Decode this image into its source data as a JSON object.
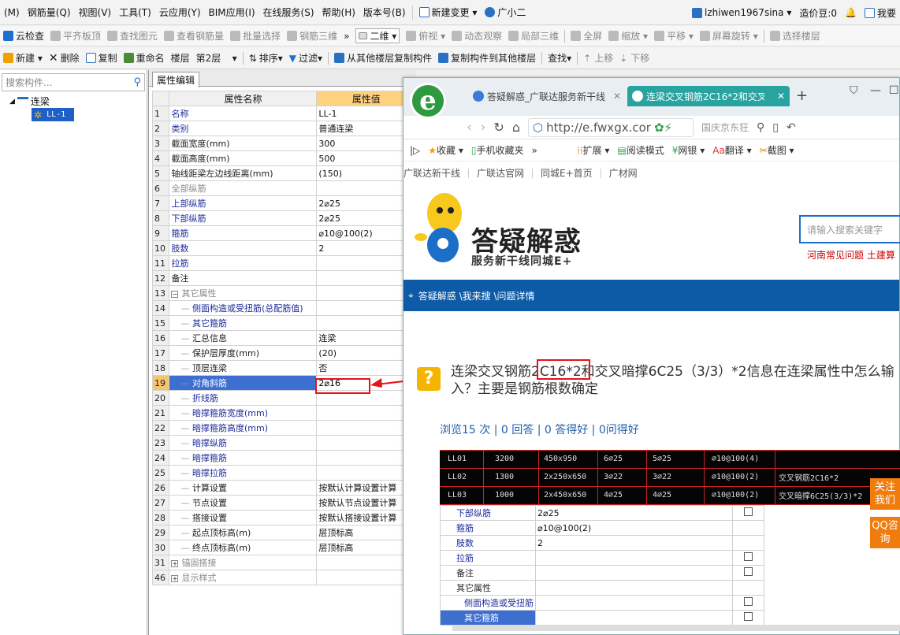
{
  "menubar": {
    "items": [
      "(M)",
      "钢筋量(Q)",
      "视图(V)",
      "工具(T)",
      "云应用(Y)",
      "BIM应用(I)",
      "在线服务(S)",
      "帮助(H)",
      "版本号(B)"
    ],
    "new_change": "新建变更",
    "assistant": "广小二",
    "user": "lzhiwen1967sina",
    "coins": "造价豆:0",
    "ask": "我要"
  },
  "toolbar1": {
    "cloud_check": "云检查",
    "flush_slab": "平齐板顶",
    "find_element": "查找图元",
    "view_rebar": "查看钢筋量",
    "batch_select": "批量选择",
    "rebar_3d": "钢筋三维",
    "view_mode": "二维",
    "top_view": "俯视",
    "dynamic_view": "动态观察",
    "local_3d": "局部三维",
    "full_screen": "全屏",
    "zoom": "缩放",
    "pan": "平移",
    "rotate": "屏幕旋转",
    "select_floor": "选择楼层"
  },
  "toolbar2": {
    "new": "新建",
    "delete": "删除",
    "copy": "复制",
    "rename": "重命名",
    "floor_label": "楼层",
    "floor_value": "第2层",
    "sort": "排序",
    "filter": "过滤",
    "copy_from": "从其他楼层复制构件",
    "copy_to": "复制构件到其他楼层",
    "find": "查找",
    "move_up": "上移",
    "move_down": "下移"
  },
  "left_panel": {
    "search_placeholder": "搜索构件...",
    "tree_root": "连梁",
    "tree_child": "LL-1"
  },
  "grid": {
    "tab": "属性编辑",
    "col_name": "属性名称",
    "col_value": "属性值",
    "rows": [
      {
        "num": "1",
        "name": "名称",
        "value": "LL-1",
        "style": "n"
      },
      {
        "num": "2",
        "name": "类别",
        "value": "普通连梁",
        "style": "n"
      },
      {
        "num": "3",
        "name": "截面宽度(mm)",
        "value": "300",
        "style": "k"
      },
      {
        "num": "4",
        "name": "截面高度(mm)",
        "value": "500",
        "style": "k"
      },
      {
        "num": "5",
        "name": "轴线距梁左边线距离(mm)",
        "value": "(150)",
        "style": "k"
      },
      {
        "num": "6",
        "name": "全部纵筋",
        "value": "",
        "style": "g"
      },
      {
        "num": "7",
        "name": "上部纵筋",
        "value": "2⌀25",
        "style": "n"
      },
      {
        "num": "8",
        "name": "下部纵筋",
        "value": "2⌀25",
        "style": "n"
      },
      {
        "num": "9",
        "name": "箍筋",
        "value": "⌀10@100(2)",
        "style": "n"
      },
      {
        "num": "10",
        "name": "肢数",
        "value": "2",
        "style": "n"
      },
      {
        "num": "11",
        "name": "拉筋",
        "value": "",
        "style": "n"
      },
      {
        "num": "12",
        "name": "备注",
        "value": "",
        "style": "k"
      },
      {
        "num": "13",
        "name": "其它属性",
        "value": "",
        "style": "g",
        "group": true
      },
      {
        "num": "14",
        "name": "侧面构造或受扭筋(总配筋值)",
        "value": "",
        "style": "n",
        "child": true
      },
      {
        "num": "15",
        "name": "其它箍筋",
        "value": "",
        "style": "n",
        "child": true
      },
      {
        "num": "16",
        "name": "汇总信息",
        "value": "连梁",
        "style": "k",
        "child": true
      },
      {
        "num": "17",
        "name": "保护层厚度(mm)",
        "value": "(20)",
        "style": "k",
        "child": true
      },
      {
        "num": "18",
        "name": "顶层连梁",
        "value": "否",
        "style": "k",
        "child": true
      },
      {
        "num": "19",
        "name": "对角斜筋",
        "value": "2⌀16",
        "style": "n",
        "child": true,
        "selected": true
      },
      {
        "num": "20",
        "name": "折线筋",
        "value": "",
        "style": "n",
        "child": true
      },
      {
        "num": "21",
        "name": "暗撑箍筋宽度(mm)",
        "value": "",
        "style": "n",
        "child": true
      },
      {
        "num": "22",
        "name": "暗撑箍筋高度(mm)",
        "value": "",
        "style": "n",
        "child": true
      },
      {
        "num": "23",
        "name": "暗撑纵筋",
        "value": "",
        "style": "n",
        "child": true
      },
      {
        "num": "24",
        "name": "暗撑箍筋",
        "value": "",
        "style": "n",
        "child": true
      },
      {
        "num": "25",
        "name": "暗撑拉筋",
        "value": "",
        "style": "n",
        "child": true
      },
      {
        "num": "26",
        "name": "计算设置",
        "value": "按默认计算设置计算",
        "style": "k",
        "child": true
      },
      {
        "num": "27",
        "name": "节点设置",
        "value": "按默认节点设置计算",
        "style": "k",
        "child": true
      },
      {
        "num": "28",
        "name": "搭接设置",
        "value": "按默认搭接设置计算",
        "style": "k",
        "child": true
      },
      {
        "num": "29",
        "name": "起点顶标高(m)",
        "value": "层顶标高",
        "style": "k",
        "child": true
      },
      {
        "num": "30",
        "name": "终点顶标高(m)",
        "value": "层顶标高",
        "style": "k",
        "child": true
      },
      {
        "num": "31",
        "name": "锚固搭接",
        "value": "",
        "style": "g",
        "group": true,
        "plus": true
      },
      {
        "num": "46",
        "name": "显示样式",
        "value": "",
        "style": "g",
        "group": true,
        "plus": true
      }
    ]
  },
  "browser": {
    "tab1": "答疑解惑_广联达服务新干线",
    "tab2": "连梁交叉钢筋2C16*2和交叉",
    "url": "http://e.fwxgx.cor",
    "search_hint": "国庆京东狂",
    "fav_collect": "收藏",
    "fav_mobile": "手机收藏夹",
    "fav_ext": "扩展",
    "fav_read": "阅读模式",
    "fav_bank": "网银",
    "fav_translate": "翻译",
    "fav_capture": "截图",
    "nav_links": [
      "广联达新干线",
      "广联达官网",
      "同城E+首页",
      "广材网"
    ],
    "hero_title": "答疑解惑",
    "hero_sub": "服务新干线同城E+",
    "search_placeholder": "请输入搜索关键字",
    "hot_links": "河南常见问题   土建算",
    "breadcrumb": "答疑解惑 \\我来搜 \\问题详情",
    "question": "连梁交叉钢筋2C16*2和交叉暗撑6C25（3/3）*2信息在连梁属性中怎么输入？主要是钢筋根数确定",
    "stats": "浏览15 次 | 0 回答 | 0 答得好 | 0问得好",
    "side_follow": "关注我们",
    "side_qq": "QQ咨询"
  },
  "qimage": {
    "rows": [
      [
        "LL01",
        "3200",
        "450x950",
        "6⌀25",
        "5⌀25",
        "⌀10@100(4)",
        ""
      ],
      [
        "LL02",
        "1300",
        "2x250x650",
        "3⌀22",
        "3⌀22",
        "⌀10@100(2)",
        "交叉钢筋2C16*2"
      ],
      [
        "LL03",
        "1000",
        "2x450x650",
        "4⌀25",
        "4⌀25",
        "⌀10@100(2)",
        "交叉暗撑6C25(3/3)*2"
      ]
    ],
    "props": [
      {
        "name": "下部纵筋",
        "value": "2⌀25"
      },
      {
        "name": "箍筋",
        "value": "⌀10@100(2)"
      },
      {
        "name": "肢数",
        "value": "2"
      },
      {
        "name": "拉筋",
        "value": ""
      },
      {
        "name": "备注",
        "value": ""
      },
      {
        "name": "其它属性",
        "value": ""
      },
      {
        "name": "侧面构造或受扭筋",
        "value": ""
      },
      {
        "name": "其它箍筋",
        "value": ""
      }
    ],
    "head_fragment": "属性名称"
  }
}
